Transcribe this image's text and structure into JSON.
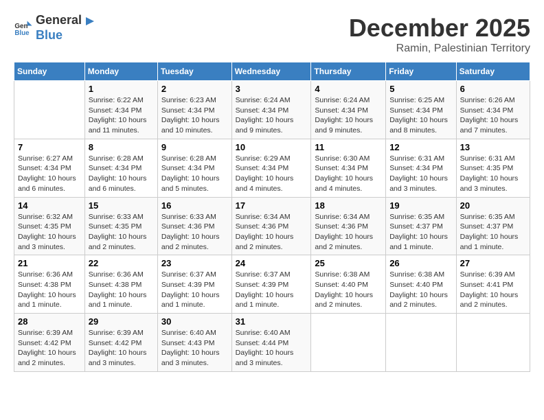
{
  "header": {
    "logo_general": "General",
    "logo_blue": "Blue",
    "month_title": "December 2025",
    "location": "Ramin, Palestinian Territory"
  },
  "days_of_week": [
    "Sunday",
    "Monday",
    "Tuesday",
    "Wednesday",
    "Thursday",
    "Friday",
    "Saturday"
  ],
  "weeks": [
    [
      {
        "day": "",
        "info": ""
      },
      {
        "day": "1",
        "info": "Sunrise: 6:22 AM\nSunset: 4:34 PM\nDaylight: 10 hours and 11 minutes."
      },
      {
        "day": "2",
        "info": "Sunrise: 6:23 AM\nSunset: 4:34 PM\nDaylight: 10 hours and 10 minutes."
      },
      {
        "day": "3",
        "info": "Sunrise: 6:24 AM\nSunset: 4:34 PM\nDaylight: 10 hours and 9 minutes."
      },
      {
        "day": "4",
        "info": "Sunrise: 6:24 AM\nSunset: 4:34 PM\nDaylight: 10 hours and 9 minutes."
      },
      {
        "day": "5",
        "info": "Sunrise: 6:25 AM\nSunset: 4:34 PM\nDaylight: 10 hours and 8 minutes."
      },
      {
        "day": "6",
        "info": "Sunrise: 6:26 AM\nSunset: 4:34 PM\nDaylight: 10 hours and 7 minutes."
      }
    ],
    [
      {
        "day": "7",
        "info": "Sunrise: 6:27 AM\nSunset: 4:34 PM\nDaylight: 10 hours and 6 minutes."
      },
      {
        "day": "8",
        "info": "Sunrise: 6:28 AM\nSunset: 4:34 PM\nDaylight: 10 hours and 6 minutes."
      },
      {
        "day": "9",
        "info": "Sunrise: 6:28 AM\nSunset: 4:34 PM\nDaylight: 10 hours and 5 minutes."
      },
      {
        "day": "10",
        "info": "Sunrise: 6:29 AM\nSunset: 4:34 PM\nDaylight: 10 hours and 4 minutes."
      },
      {
        "day": "11",
        "info": "Sunrise: 6:30 AM\nSunset: 4:34 PM\nDaylight: 10 hours and 4 minutes."
      },
      {
        "day": "12",
        "info": "Sunrise: 6:31 AM\nSunset: 4:34 PM\nDaylight: 10 hours and 3 minutes."
      },
      {
        "day": "13",
        "info": "Sunrise: 6:31 AM\nSunset: 4:35 PM\nDaylight: 10 hours and 3 minutes."
      }
    ],
    [
      {
        "day": "14",
        "info": "Sunrise: 6:32 AM\nSunset: 4:35 PM\nDaylight: 10 hours and 3 minutes."
      },
      {
        "day": "15",
        "info": "Sunrise: 6:33 AM\nSunset: 4:35 PM\nDaylight: 10 hours and 2 minutes."
      },
      {
        "day": "16",
        "info": "Sunrise: 6:33 AM\nSunset: 4:36 PM\nDaylight: 10 hours and 2 minutes."
      },
      {
        "day": "17",
        "info": "Sunrise: 6:34 AM\nSunset: 4:36 PM\nDaylight: 10 hours and 2 minutes."
      },
      {
        "day": "18",
        "info": "Sunrise: 6:34 AM\nSunset: 4:36 PM\nDaylight: 10 hours and 2 minutes."
      },
      {
        "day": "19",
        "info": "Sunrise: 6:35 AM\nSunset: 4:37 PM\nDaylight: 10 hours and 1 minute."
      },
      {
        "day": "20",
        "info": "Sunrise: 6:35 AM\nSunset: 4:37 PM\nDaylight: 10 hours and 1 minute."
      }
    ],
    [
      {
        "day": "21",
        "info": "Sunrise: 6:36 AM\nSunset: 4:38 PM\nDaylight: 10 hours and 1 minute."
      },
      {
        "day": "22",
        "info": "Sunrise: 6:36 AM\nSunset: 4:38 PM\nDaylight: 10 hours and 1 minute."
      },
      {
        "day": "23",
        "info": "Sunrise: 6:37 AM\nSunset: 4:39 PM\nDaylight: 10 hours and 1 minute."
      },
      {
        "day": "24",
        "info": "Sunrise: 6:37 AM\nSunset: 4:39 PM\nDaylight: 10 hours and 1 minute."
      },
      {
        "day": "25",
        "info": "Sunrise: 6:38 AM\nSunset: 4:40 PM\nDaylight: 10 hours and 2 minutes."
      },
      {
        "day": "26",
        "info": "Sunrise: 6:38 AM\nSunset: 4:40 PM\nDaylight: 10 hours and 2 minutes."
      },
      {
        "day": "27",
        "info": "Sunrise: 6:39 AM\nSunset: 4:41 PM\nDaylight: 10 hours and 2 minutes."
      }
    ],
    [
      {
        "day": "28",
        "info": "Sunrise: 6:39 AM\nSunset: 4:42 PM\nDaylight: 10 hours and 2 minutes."
      },
      {
        "day": "29",
        "info": "Sunrise: 6:39 AM\nSunset: 4:42 PM\nDaylight: 10 hours and 3 minutes."
      },
      {
        "day": "30",
        "info": "Sunrise: 6:40 AM\nSunset: 4:43 PM\nDaylight: 10 hours and 3 minutes."
      },
      {
        "day": "31",
        "info": "Sunrise: 6:40 AM\nSunset: 4:44 PM\nDaylight: 10 hours and 3 minutes."
      },
      {
        "day": "",
        "info": ""
      },
      {
        "day": "",
        "info": ""
      },
      {
        "day": "",
        "info": ""
      }
    ]
  ]
}
